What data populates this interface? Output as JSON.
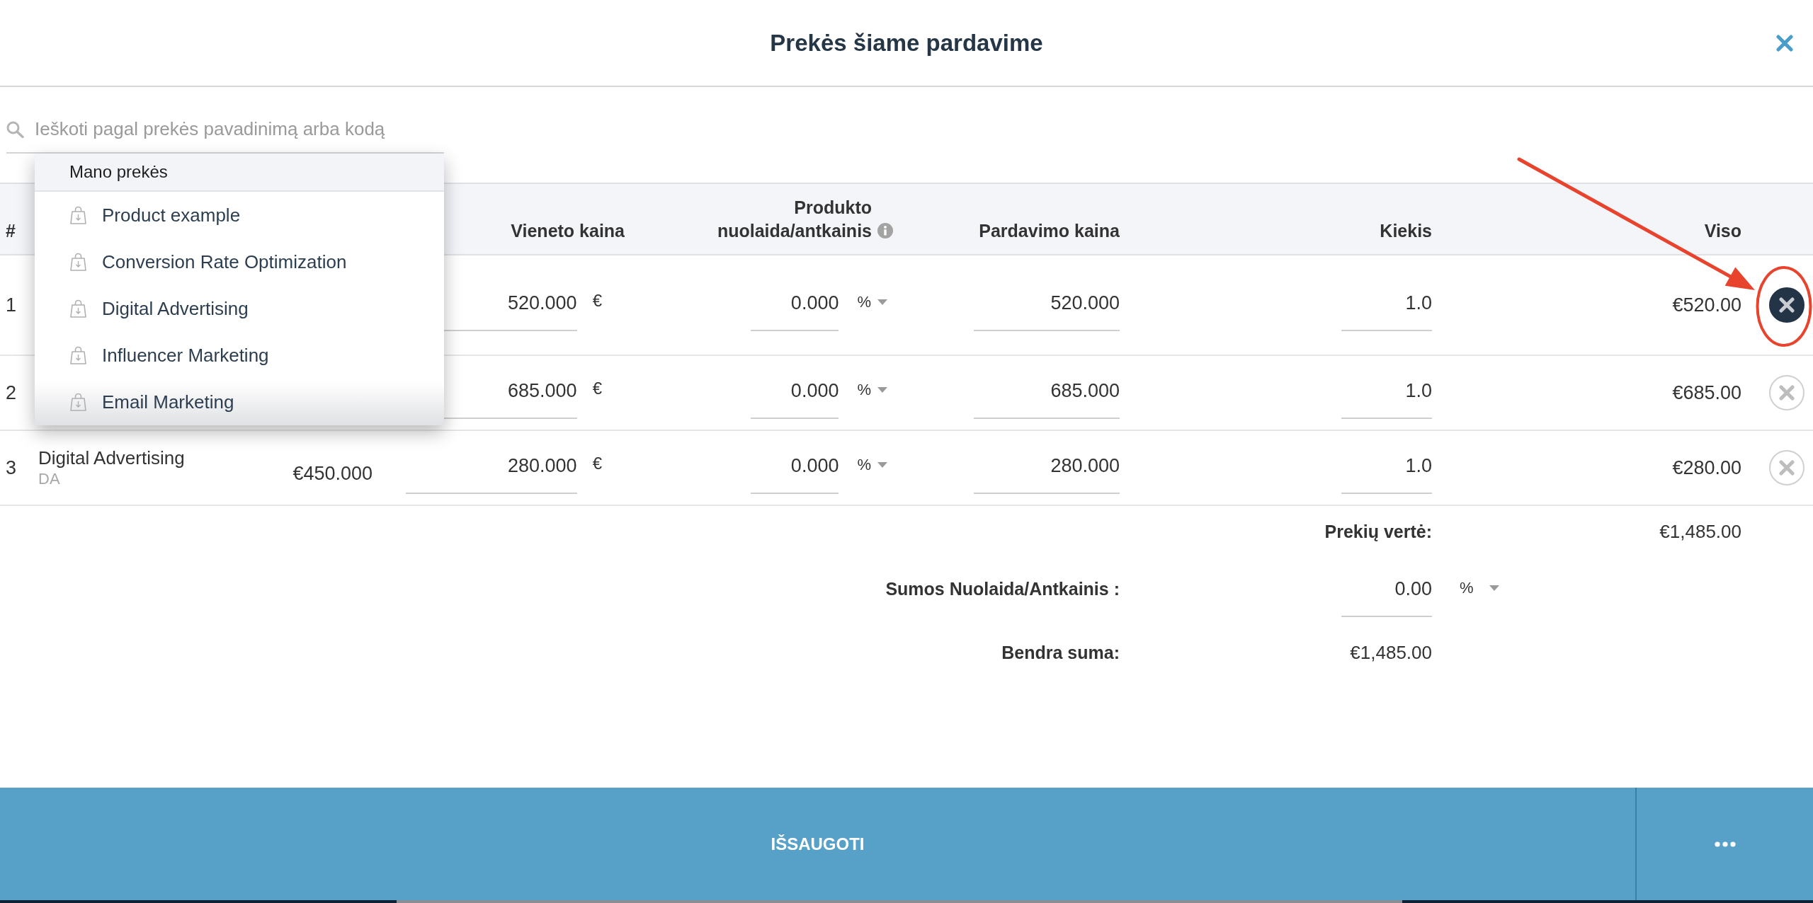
{
  "modal": {
    "title": "Prekės šiame pardavime"
  },
  "search": {
    "placeholder": "Ieškoti pagal prekės pavadinimą arba kodą"
  },
  "dropdown": {
    "header": "Mano prekės",
    "items": [
      "Product example",
      "Conversion Rate Optimization",
      "Digital Advertising",
      "Influencer Marketing",
      "Email Marketing"
    ]
  },
  "table": {
    "columns": [
      {
        "label": "#",
        "info": false
      },
      {
        "label": "Vieneto kaina",
        "info": false
      },
      {
        "label": "Produkto nuolaida/antkainis",
        "info": true
      },
      {
        "label": "Pardavimo kaina",
        "info": false
      },
      {
        "label": "Kiekis",
        "info": false
      },
      {
        "label": "Viso",
        "info": false
      }
    ],
    "rows": [
      {
        "number": "1",
        "unit_price": "520.000",
        "currency": "€",
        "discount": "0.000",
        "discount_unit": "%",
        "sale_price": "520.000",
        "quantity": "1.0",
        "total": "€520.00",
        "highlighted": true
      },
      {
        "number": "2",
        "unit_price": "685.000",
        "currency": "€",
        "discount": "0.000",
        "discount_unit": "%",
        "sale_price": "685.000",
        "quantity": "1.0",
        "total": "€685.00",
        "highlighted": false
      },
      {
        "number": "3",
        "name": "Digital Advertising",
        "code": "DA",
        "list_price": "€450.000",
        "unit_price": "280.000",
        "currency": "€",
        "discount": "0.000",
        "discount_unit": "%",
        "sale_price": "280.000",
        "quantity": "1.0",
        "total": "€280.00",
        "highlighted": false
      }
    ]
  },
  "totals": {
    "subtotal_label": "Prekių vertė:",
    "subtotal": "€1,485.00",
    "discount_label": "Sumos Nuolaida/Antkainis :",
    "discount": "0.00",
    "discount_unit": "%",
    "grand_total_label": "Bendra suma:",
    "grand_total": "€1,485.00"
  },
  "footer": {
    "save_button": "IŠSAUGOTI"
  }
}
